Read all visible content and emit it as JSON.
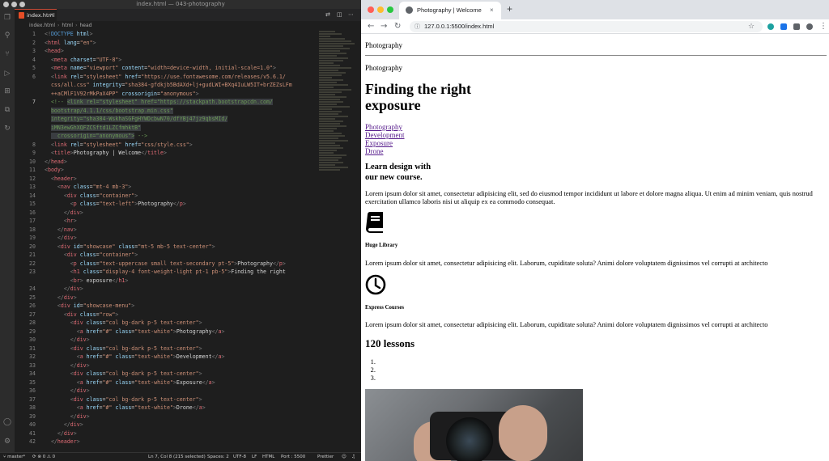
{
  "vscode": {
    "window_title": "index.html — 043-photography",
    "tab": {
      "label": "index.html",
      "close": "×"
    },
    "breadcrumb": [
      "index.html",
      "html",
      "head"
    ],
    "code_lines": [
      {
        "n": "1",
        "html": "<span class='t-bracket'>&lt;!</span><span class='t-doctype'>DOCTYPE</span> <span class='t-attr'>html</span><span class='t-bracket'>&gt;</span>"
      },
      {
        "n": "2",
        "html": "<span class='t-bracket'>&lt;</span><span class='t-tag'>html</span> <span class='t-attr'>lang</span>=<span class='t-str'>\"en\"</span><span class='t-bracket'>&gt;</span>"
      },
      {
        "n": "3",
        "html": "<span class='t-bracket'>&lt;</span><span class='t-tag'>head</span><span class='t-bracket'>&gt;</span>"
      },
      {
        "n": "4",
        "html": "  <span class='t-bracket'>&lt;</span><span class='t-tag'>meta</span> <span class='t-attr'>charset</span>=<span class='t-str'>\"UTF-8\"</span><span class='t-bracket'>&gt;</span>"
      },
      {
        "n": "5",
        "html": "  <span class='t-bracket'>&lt;</span><span class='t-tag'>meta</span> <span class='t-attr'>name</span>=<span class='t-str'>\"viewport\"</span> <span class='t-attr'>content</span>=<span class='t-str'>\"width=device-width, initial-scale=1.0\"</span><span class='t-bracket'>&gt;</span>"
      },
      {
        "n": "6",
        "html": "  <span class='t-bracket'>&lt;</span><span class='t-tag'>link</span> <span class='t-attr'>rel</span>=<span class='t-str'>\"stylesheet\"</span> <span class='t-attr'>href</span>=<span class='t-str'>\"https://use.fontawesome.com/releases/v5.6.1/</span>"
      },
      {
        "n": "",
        "html": "  <span class='t-str'>css/all.css\"</span> <span class='t-attr'>integrity</span>=<span class='t-str'>\"sha384-gfdkjb5BdAXd+lj+gudLWI+BXq4IuLW5IT+brZEZsLFm</span>"
      },
      {
        "n": "",
        "html": "  <span class='t-str'>++aCMlF1V92rMkPaX4PP\"</span> <span class='t-attr'>crossorigin</span>=<span class='t-str'>\"anonymous\"</span><span class='t-bracket'>&gt;</span>"
      },
      {
        "n": "7",
        "html": "  <span class='t-comment'>&lt;!-- <span class='sel'>&lt;link rel=\"stylesheet\" href=\"https://stackpath.bootstrapcdn.com/</span></span>",
        "active": true
      },
      {
        "n": "",
        "html": "  <span class='t-comment sel'>bootstrap/4.1.1/css/bootstrap.min.css\"</span>"
      },
      {
        "n": "",
        "html": "  <span class='t-comment sel'>integrity=\"sha384-WskhaSGFgHYWDcbwN70/dfYBj47jz9qbsMId/</span>"
      },
      {
        "n": "",
        "html": "  <span class='t-comment sel'>iMN3ewGhXQFZCSftd1LZCfmhktB\"</span>"
      },
      {
        "n": "",
        "html": "  <span class='t-comment'><span class='sel'>  crossorigin=\"anonymous\"&gt;</span> --&gt;</span>"
      },
      {
        "n": "8",
        "html": "  <span class='t-bracket'>&lt;</span><span class='t-tag'>link</span> <span class='t-attr'>rel</span>=<span class='t-str'>\"stylesheet\"</span> <span class='t-attr'>href</span>=<span class='t-str'>\"css/style.css\"</span><span class='t-bracket'>&gt;</span>"
      },
      {
        "n": "9",
        "html": "  <span class='t-bracket'>&lt;</span><span class='t-tag'>title</span><span class='t-bracket'>&gt;</span>Photography | Welcome<span class='t-bracket'>&lt;/</span><span class='t-tag'>title</span><span class='t-bracket'>&gt;</span>"
      },
      {
        "n": "10",
        "html": "<span class='t-bracket'>&lt;/</span><span class='t-tag'>head</span><span class='t-bracket'>&gt;</span>"
      },
      {
        "n": "11",
        "html": "<span class='t-bracket'>&lt;</span><span class='t-tag'>body</span><span class='t-bracket'>&gt;</span>"
      },
      {
        "n": "12",
        "html": "  <span class='t-bracket'>&lt;</span><span class='t-tag'>header</span><span class='t-bracket'>&gt;</span>"
      },
      {
        "n": "13",
        "html": "    <span class='t-bracket'>&lt;</span><span class='t-tag'>nav</span> <span class='t-attr'>class</span>=<span class='t-str'>\"mt-4 mb-3\"</span><span class='t-bracket'>&gt;</span>"
      },
      {
        "n": "14",
        "html": "      <span class='t-bracket'>&lt;</span><span class='t-tag'>div</span> <span class='t-attr'>class</span>=<span class='t-str'>\"container\"</span><span class='t-bracket'>&gt;</span>"
      },
      {
        "n": "15",
        "html": "        <span class='t-bracket'>&lt;</span><span class='t-tag'>p</span> <span class='t-attr'>class</span>=<span class='t-str'>\"text-left\"</span><span class='t-bracket'>&gt;</span>Photography<span class='t-bracket'>&lt;/</span><span class='t-tag'>p</span><span class='t-bracket'>&gt;</span>"
      },
      {
        "n": "16",
        "html": "      <span class='t-bracket'>&lt;/</span><span class='t-tag'>div</span><span class='t-bracket'>&gt;</span>"
      },
      {
        "n": "17",
        "html": "      <span class='t-bracket'>&lt;</span><span class='t-tag'>hr</span><span class='t-bracket'>&gt;</span>"
      },
      {
        "n": "18",
        "html": "    <span class='t-bracket'>&lt;/</span><span class='t-tag'>nav</span><span class='t-bracket'>&gt;</span>"
      },
      {
        "n": "19",
        "html": "    <span class='t-bracket'>&lt;/</span><span class='t-tag'>div</span><span class='t-bracket'>&gt;</span>"
      },
      {
        "n": "20",
        "html": "    <span class='t-bracket'>&lt;</span><span class='t-tag'>div</span> <span class='t-attr'>id</span>=<span class='t-str'>\"showcase\"</span> <span class='t-attr'>class</span>=<span class='t-str'>\"mt-5 mb-5 text-center\"</span><span class='t-bracket'>&gt;</span>"
      },
      {
        "n": "21",
        "html": "      <span class='t-bracket'>&lt;</span><span class='t-tag'>div</span> <span class='t-attr'>class</span>=<span class='t-str'>\"container\"</span><span class='t-bracket'>&gt;</span>"
      },
      {
        "n": "22",
        "html": "        <span class='t-bracket'>&lt;</span><span class='t-tag'>p</span> <span class='t-attr'>class</span>=<span class='t-str'>\"text-uppercase small text-secondary pt-5\"</span><span class='t-bracket'>&gt;</span>Photography<span class='t-bracket'>&lt;/</span><span class='t-tag'>p</span><span class='t-bracket'>&gt;</span>"
      },
      {
        "n": "23",
        "html": "        <span class='t-bracket'>&lt;</span><span class='t-tag'>h1</span> <span class='t-attr'>class</span>=<span class='t-str'>\"display-4 font-weight-light pt-1 pb-5\"</span><span class='t-bracket'>&gt;</span>Finding the right"
      },
      {
        "n": "",
        "html": "        <span class='t-bracket'>&lt;</span><span class='t-tag'>br</span><span class='t-bracket'>&gt;</span> exposure<span class='t-bracket'>&lt;/</span><span class='t-tag'>h1</span><span class='t-bracket'>&gt;</span>"
      },
      {
        "n": "24",
        "html": "      <span class='t-bracket'>&lt;/</span><span class='t-tag'>div</span><span class='t-bracket'>&gt;</span>"
      },
      {
        "n": "25",
        "html": "    <span class='t-bracket'>&lt;/</span><span class='t-tag'>div</span><span class='t-bracket'>&gt;</span>"
      },
      {
        "n": "26",
        "html": "    <span class='t-bracket'>&lt;</span><span class='t-tag'>div</span> <span class='t-attr'>id</span>=<span class='t-str'>\"showcase-menu\"</span><span class='t-bracket'>&gt;</span>"
      },
      {
        "n": "27",
        "html": "      <span class='t-bracket'>&lt;</span><span class='t-tag'>div</span> <span class='t-attr'>class</span>=<span class='t-str'>\"row\"</span><span class='t-bracket'>&gt;</span>"
      },
      {
        "n": "28",
        "html": "        <span class='t-bracket'>&lt;</span><span class='t-tag'>div</span> <span class='t-attr'>class</span>=<span class='t-str'>\"col bg-dark p-5 text-center\"</span><span class='t-bracket'>&gt;</span>"
      },
      {
        "n": "29",
        "html": "          <span class='t-bracket'>&lt;</span><span class='t-tag'>a</span> <span class='t-attr'>href</span>=<span class='t-str'>\"#\"</span> <span class='t-attr'>class</span>=<span class='t-str'>\"text-white\"</span><span class='t-bracket'>&gt;</span>Photography<span class='t-bracket'>&lt;/</span><span class='t-tag'>a</span><span class='t-bracket'>&gt;</span>"
      },
      {
        "n": "30",
        "html": "        <span class='t-bracket'>&lt;/</span><span class='t-tag'>div</span><span class='t-bracket'>&gt;</span>"
      },
      {
        "n": "31",
        "html": "        <span class='t-bracket'>&lt;</span><span class='t-tag'>div</span> <span class='t-attr'>class</span>=<span class='t-str'>\"col bg-dark p-5 text-center\"</span><span class='t-bracket'>&gt;</span>"
      },
      {
        "n": "32",
        "html": "          <span class='t-bracket'>&lt;</span><span class='t-tag'>a</span> <span class='t-attr'>href</span>=<span class='t-str'>\"#\"</span> <span class='t-attr'>class</span>=<span class='t-str'>\"text-white\"</span><span class='t-bracket'>&gt;</span>Development<span class='t-bracket'>&lt;/</span><span class='t-tag'>a</span><span class='t-bracket'>&gt;</span>"
      },
      {
        "n": "33",
        "html": "        <span class='t-bracket'>&lt;/</span><span class='t-tag'>div</span><span class='t-bracket'>&gt;</span>"
      },
      {
        "n": "34",
        "html": "        <span class='t-bracket'>&lt;</span><span class='t-tag'>div</span> <span class='t-attr'>class</span>=<span class='t-str'>\"col bg-dark p-5 text-center\"</span><span class='t-bracket'>&gt;</span>"
      },
      {
        "n": "35",
        "html": "          <span class='t-bracket'>&lt;</span><span class='t-tag'>a</span> <span class='t-attr'>href</span>=<span class='t-str'>\"#\"</span> <span class='t-attr'>class</span>=<span class='t-str'>\"text-white\"</span><span class='t-bracket'>&gt;</span>Exposure<span class='t-bracket'>&lt;/</span><span class='t-tag'>a</span><span class='t-bracket'>&gt;</span>"
      },
      {
        "n": "36",
        "html": "        <span class='t-bracket'>&lt;/</span><span class='t-tag'>div</span><span class='t-bracket'>&gt;</span>"
      },
      {
        "n": "37",
        "html": "        <span class='t-bracket'>&lt;</span><span class='t-tag'>div</span> <span class='t-attr'>class</span>=<span class='t-str'>\"col bg-dark p-5 text-center\"</span><span class='t-bracket'>&gt;</span>"
      },
      {
        "n": "38",
        "html": "          <span class='t-bracket'>&lt;</span><span class='t-tag'>a</span> <span class='t-attr'>href</span>=<span class='t-str'>\"#\"</span> <span class='t-attr'>class</span>=<span class='t-str'>\"text-white\"</span><span class='t-bracket'>&gt;</span>Drone<span class='t-bracket'>&lt;/</span><span class='t-tag'>a</span><span class='t-bracket'>&gt;</span>"
      },
      {
        "n": "39",
        "html": "        <span class='t-bracket'>&lt;/</span><span class='t-tag'>div</span><span class='t-bracket'>&gt;</span>"
      },
      {
        "n": "40",
        "html": "      <span class='t-bracket'>&lt;/</span><span class='t-tag'>div</span><span class='t-bracket'>&gt;</span>"
      },
      {
        "n": "41",
        "html": "    <span class='t-bracket'>&lt;/</span><span class='t-tag'>div</span><span class='t-bracket'>&gt;</span>"
      },
      {
        "n": "42",
        "html": "  <span class='t-bracket'>&lt;/</span><span class='t-tag'>header</span><span class='t-bracket'>&gt;</span>"
      }
    ],
    "status": {
      "branch": "master*",
      "position": "Ln 7, Col 8 (215 selected)",
      "spaces": "Spaces: 2",
      "encoding": "UTF-8",
      "eol": "LF",
      "language": "HTML",
      "port": "Port : 5500",
      "formatter": "Prettier"
    }
  },
  "chrome": {
    "tab_title": "Photography | Welcome",
    "tab_close": "×",
    "new_tab": "+",
    "url": "127.0.0.1:5500/index.html",
    "traffic_colors": [
      "#ff5f57",
      "#febc2e",
      "#28c840"
    ],
    "extension_colors": [
      "#1da1a0",
      "#1a73e8",
      "#5f6368",
      "#5f6368"
    ]
  },
  "page": {
    "nav_text": "Photography",
    "showcase_label": "Photography",
    "heading_line1": "Finding the right",
    "heading_line2": "exposure",
    "menu": [
      "Photography",
      "Development",
      "Exposure",
      "Drone"
    ],
    "learn_line1": "Learn design with",
    "learn_line2": "our new course.",
    "lorem_long": "Lorem ipsum dolor sit amet, consectetur adipisicing elit, sed do eiusmod tempor incididunt ut labore et dolore magna aliqua. Ut enim ad minim veniam, quis nostrud exercitation ullamco laboris nisi ut aliquip ex ea commodo consequat.",
    "feature1_title": "Huge Library",
    "feature1_text": "Lorem ipsum dolor sit amet, consectetur adipisicing elit. Laborum, cupiditate soluta? Animi dolore voluptatem dignissimos vel corrupti at architecto",
    "feature2_title": "Express Courses",
    "feature2_text": "Lorem ipsum dolor sit amet, consectetur adipisicing elit. Laborum, cupiditate soluta? Animi dolore voluptatem dignissimos vel corrupti at architecto",
    "lessons_heading": "120 lessons",
    "list_items": [
      "",
      "",
      ""
    ]
  }
}
